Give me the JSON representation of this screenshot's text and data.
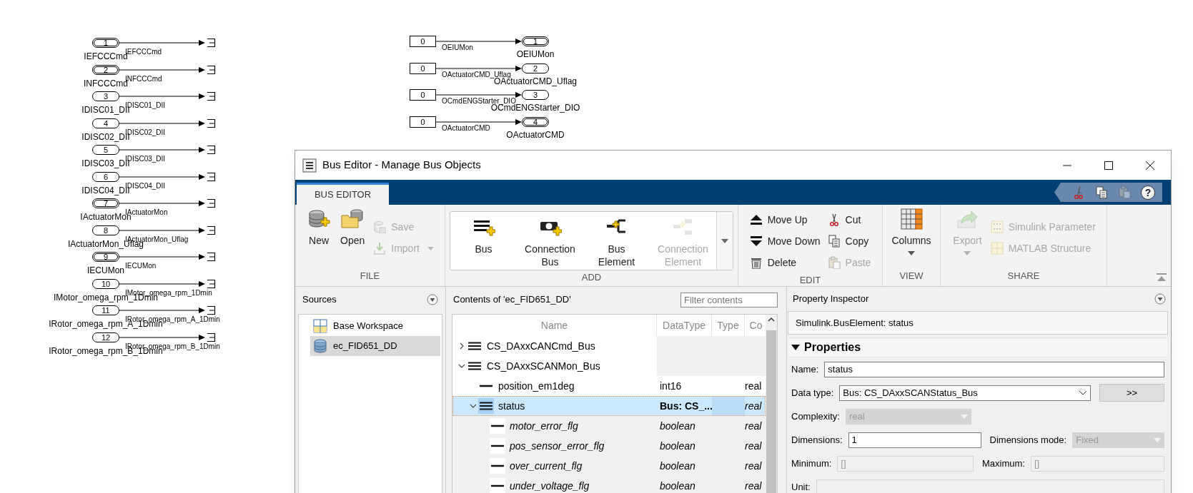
{
  "diagram": {
    "inports": [
      {
        "number": "1",
        "name": "IEFCCCmd",
        "signal": "IEFCCCmd",
        "kind": "double"
      },
      {
        "number": "2",
        "name": "INFCCCmd",
        "signal": "INFCCCmd",
        "kind": "double"
      },
      {
        "number": "3",
        "name": "IDISC01_DII",
        "signal": "IDISC01_DII",
        "kind": "single"
      },
      {
        "number": "4",
        "name": "IDISC02_DII",
        "signal": "IDISC02_DII",
        "kind": "single"
      },
      {
        "number": "5",
        "name": "IDISC03_DII",
        "signal": "IDISC03_DII",
        "kind": "single"
      },
      {
        "number": "6",
        "name": "IDISC04_DII",
        "signal": "IDISC04_DII",
        "kind": "single"
      },
      {
        "number": "7",
        "name": "IActuatorMon",
        "signal": "IActuatorMon",
        "kind": "double"
      },
      {
        "number": "8",
        "name": "IActuatorMon_Uflag",
        "signal": "IActuatorMon_Uflag",
        "kind": "single"
      },
      {
        "number": "9",
        "name": "IECUMon",
        "signal": "IECUMon",
        "kind": "double"
      },
      {
        "number": "10",
        "name": "IMotor_omega_rpm_1Dmin",
        "signal": "IMotor_omega_rpm_1Dmin",
        "kind": "single"
      },
      {
        "number": "11",
        "name": "IRotor_omega_rpm_A_1Dmin",
        "signal": "IRotor_omega_rpm_A_1Dmin",
        "kind": "single"
      },
      {
        "number": "12",
        "name": "IRotor_omega_rpm_B_1Dmin",
        "signal": "IRotor_omega_rpm_B_1Dmin",
        "kind": "single"
      }
    ],
    "outputs": [
      {
        "value": "0",
        "signal": "OEIUMon",
        "number": "1",
        "name": "OEIUMon",
        "kind": "double"
      },
      {
        "value": "0",
        "signal": "OActuatorCMD_Uflag",
        "number": "2",
        "name": "OActuatorCMD_Uflag",
        "kind": "single"
      },
      {
        "value": "0",
        "signal": "OCmdENGStarter_DIO",
        "number": "3",
        "name": "OCmdENGStarter_DIO",
        "kind": "single"
      },
      {
        "value": "0",
        "signal": "OActuatorCMD",
        "number": "4",
        "name": "OActuatorCMD",
        "kind": "double"
      }
    ]
  },
  "bus_editor": {
    "title": "Bus Editor - Manage Bus Objects",
    "tabs": [
      {
        "label": "BUS EDITOR",
        "selected": true
      }
    ],
    "quick_access": [
      {
        "disabled": false
      },
      {
        "disabled": false
      },
      {
        "disabled": true
      },
      {
        "label": "?",
        "disabled": false
      }
    ],
    "ribbon": [
      {
        "title": "FILE",
        "kind": "buttons",
        "columns": [
          [
            {
              "label": "New",
              "kind": "large",
              "disabled": false
            }
          ],
          [
            {
              "label": "Open",
              "kind": "large",
              "disabled": false
            }
          ],
          [
            {
              "label": "Save",
              "kind": "small",
              "disabled": true
            },
            {
              "label": "Import",
              "kind": "small",
              "disabled": true,
              "menu": true
            }
          ]
        ]
      },
      {
        "title": "ADD",
        "kind": "gallery",
        "columns": [
          [
            {
              "label": "Bus",
              "kind": "large",
              "disabled": false
            }
          ],
          [
            {
              "label": "Connection Bus",
              "kind": "large",
              "disabled": false
            }
          ],
          [
            {
              "label": "Bus Element",
              "kind": "large",
              "disabled": false
            }
          ],
          [
            {
              "label": "Connection Element",
              "kind": "large",
              "disabled": true
            }
          ]
        ]
      },
      {
        "title": "EDIT",
        "kind": "buttons",
        "columns": [
          [
            {
              "label": "Move Up",
              "kind": "small",
              "disabled": false
            },
            {
              "label": "Move Down",
              "kind": "small",
              "disabled": false
            },
            {
              "label": "Delete",
              "kind": "small",
              "disabled": false
            }
          ],
          [
            {
              "label": "Cut",
              "kind": "small",
              "disabled": false
            },
            {
              "label": "Copy",
              "kind": "small",
              "disabled": false
            },
            {
              "label": "Paste",
              "kind": "small",
              "disabled": true
            }
          ]
        ]
      },
      {
        "title": "VIEW",
        "kind": "buttons",
        "columns": [
          [
            {
              "label": "Columns",
              "kind": "large",
              "disabled": false,
              "menu": true
            }
          ]
        ]
      },
      {
        "title": "SHARE",
        "kind": "buttons",
        "columns": [
          [
            {
              "label": "Export",
              "kind": "large",
              "disabled": true,
              "menu": true
            }
          ],
          [
            {
              "label": "Simulink Parameter",
              "kind": "small",
              "disabled": true
            },
            {
              "label": "MATLAB Structure",
              "kind": "small",
              "disabled": true
            }
          ]
        ]
      }
    ],
    "sources": {
      "title": "Sources",
      "items": [
        {
          "label": "Base Workspace",
          "selected": false
        },
        {
          "label": "ec_FID651_DD",
          "selected": true
        }
      ]
    },
    "contents": {
      "title": "Contents of 'ec_FID651_DD'",
      "filter_placeholder": "Filter contents",
      "columns": [
        "Name",
        "DataType",
        "Type",
        "Co"
      ],
      "rows": [
        {
          "name": "CS_DAxxCANCmd_Bus",
          "kind": "bus",
          "expanded": false,
          "selected": false
        },
        {
          "name": "CS_DAxxSCANMon_Bus",
          "kind": "bus",
          "expanded": true,
          "selected": false,
          "children": [
            {
              "name": "position_em1deg",
              "kind": "element",
              "datatype": "int16",
              "complexity": "real",
              "selected": false
            },
            {
              "name": "status",
              "kind": "bus",
              "expanded": true,
              "selected": true,
              "datatype": "Bus: CS_...",
              "complexity": "real",
              "children": [
                {
                  "name": "motor_error_flg",
                  "kind": "element",
                  "datatype": "boolean",
                  "complexity": "real",
                  "selected": false
                },
                {
                  "name": "pos_sensor_error_flg",
                  "kind": "element",
                  "datatype": "boolean",
                  "complexity": "real",
                  "selected": false
                },
                {
                  "name": "over_current_flg",
                  "kind": "element",
                  "datatype": "boolean",
                  "complexity": "real",
                  "selected": false
                },
                {
                  "name": "under_voltage_flg",
                  "kind": "element",
                  "datatype": "boolean",
                  "complexity": "real",
                  "selected": false
                }
              ]
            }
          ]
        }
      ]
    },
    "inspector": {
      "title": "Property Inspector",
      "object": "Simulink.BusElement: status",
      "section": {
        "label": "Properties",
        "expanded": true
      },
      "fields": [
        [
          {
            "label": "Name:",
            "value": "status",
            "kind": "text",
            "disabled": false
          }
        ],
        [
          {
            "label": "Data type:",
            "value": "Bus: CS_DAxxSCANStatus_Bus",
            "kind": "select",
            "disabled": false,
            "button": ">>"
          }
        ],
        [
          {
            "label": "Complexity:",
            "value": "real",
            "kind": "select",
            "disabled": true
          }
        ],
        [
          {
            "label": "Dimensions:",
            "value": "1",
            "kind": "text",
            "disabled": false
          },
          {
            "label": "Dimensions mode:",
            "value": "Fixed",
            "kind": "select",
            "disabled": true
          }
        ],
        [
          {
            "label": "Minimum:",
            "value": "[]",
            "kind": "text",
            "disabled": true
          },
          {
            "label": "Maximum:",
            "value": "[]",
            "kind": "text",
            "disabled": true
          }
        ],
        [
          {
            "label": "Unit:",
            "kind": "text",
            "disabled": true
          }
        ]
      ]
    }
  }
}
